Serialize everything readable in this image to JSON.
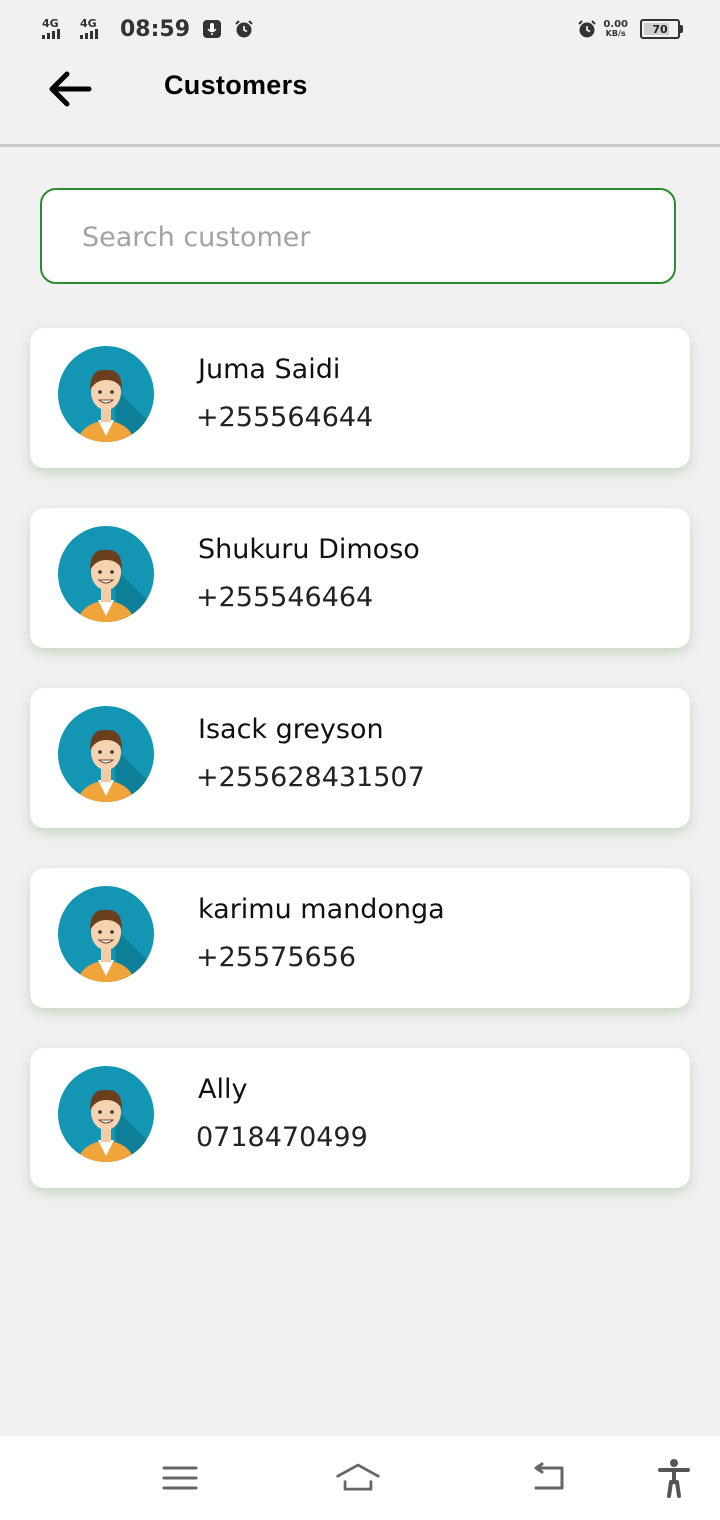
{
  "status_bar": {
    "network_1": "4G",
    "network_2": "4G",
    "time": "08:59",
    "speed_value": "0.00",
    "speed_unit": "KB/s",
    "battery_level": "70",
    "battery_fraction": 0.7
  },
  "header": {
    "title": "Customers"
  },
  "search": {
    "placeholder": "Search customer",
    "value": ""
  },
  "customers": [
    {
      "name": "Juma Saidi",
      "phone": "+255564644"
    },
    {
      "name": "Shukuru Dimoso",
      "phone": "+255546464"
    },
    {
      "name": "Isack greyson",
      "phone": "+255628431507"
    },
    {
      "name": "karimu mandonga",
      "phone": "+25575656"
    },
    {
      "name": "Ally",
      "phone": "0718470499"
    }
  ],
  "icons": {
    "back": "arrow-left-icon",
    "avatar": "person-avatar-icon",
    "menu": "menu-lines-icon",
    "home": "home-icon",
    "return": "return-icon",
    "accessibility": "accessibility-icon"
  },
  "colors": {
    "accent_border": "#2e8a2e",
    "background": "#f1f1f1",
    "card": "#ffffff",
    "avatar_bg": "#1296b3",
    "shirt": "#f0a43a"
  }
}
